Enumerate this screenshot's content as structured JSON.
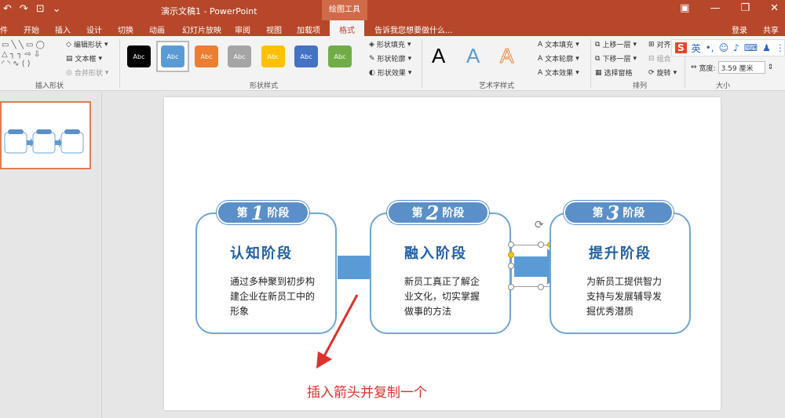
{
  "titlebar": {
    "document": "演示文稿1 - PowerPoint",
    "context_tab": "绘图工具"
  },
  "tabs": [
    {
      "label": "件"
    },
    {
      "label": "开始"
    },
    {
      "label": "插入"
    },
    {
      "label": "设计"
    },
    {
      "label": "切换"
    },
    {
      "label": "动画"
    },
    {
      "label": "幻灯片放映"
    },
    {
      "label": "审阅"
    },
    {
      "label": "视图"
    },
    {
      "label": "加载项"
    },
    {
      "label": "格式"
    }
  ],
  "tell_me": "告诉我您想要做什么...",
  "account": {
    "login": "登录",
    "share": "共享"
  },
  "ribbon": {
    "insert_shapes": {
      "edit_shape": "编辑形状",
      "text_box": "文本框",
      "merge_shapes": "合并形状",
      "label": "插入形状"
    },
    "shape_styles": {
      "swatches": [
        {
          "label": "Abc",
          "color": "#000000"
        },
        {
          "label": "Abc",
          "color": "#5b9bd5"
        },
        {
          "label": "Abc",
          "color": "#ed7d31"
        },
        {
          "label": "Abc",
          "color": "#a5a5a5"
        },
        {
          "label": "Abc",
          "color": "#ffc000"
        },
        {
          "label": "Abc",
          "color": "#4472c4"
        },
        {
          "label": "Abc",
          "color": "#70ad47"
        }
      ],
      "fill": "形状填充",
      "outline": "形状轮廓",
      "effects": "形状效果",
      "label": "形状样式"
    },
    "wordart": {
      "letters": [
        "A",
        "A",
        "A"
      ],
      "fill": "文本填充",
      "outline": "文本轮廓",
      "effects": "文本效果",
      "label": "艺术字样式"
    },
    "arrange": {
      "bring_forward": "上移一层",
      "send_backward": "下移一层",
      "selection_pane": "选择窗格",
      "align": "对齐",
      "group": "组合",
      "rotate": "旋转",
      "label": "排列"
    },
    "size": {
      "width_label": "宽度:",
      "width_value": "3.59 厘米",
      "label": "大小"
    }
  },
  "ime": {
    "lang": "英"
  },
  "slide": {
    "stages": [
      {
        "prefix": "第",
        "num": "1",
        "suffix": "阶段",
        "title": "认知阶段",
        "body": "通过多种聚到初步构建企业在新员工中的形象"
      },
      {
        "prefix": "第",
        "num": "2",
        "suffix": "阶段",
        "title": "融入阶段",
        "body": "新员工真正了解企业文化，切实掌握做事的方法"
      },
      {
        "prefix": "第",
        "num": "3",
        "suffix": "阶段",
        "title": "提升阶段",
        "body": "为新员工提供智力支持与发展辅导发掘优秀潜质"
      }
    ],
    "annotation": "插入箭头并复制一个",
    "colors": {
      "arrow": "#5b9bd5",
      "border": "#6ea6d6",
      "tab": "#5b8fc9",
      "title": "#1f5fa8",
      "annotation": "#e0302c"
    }
  }
}
